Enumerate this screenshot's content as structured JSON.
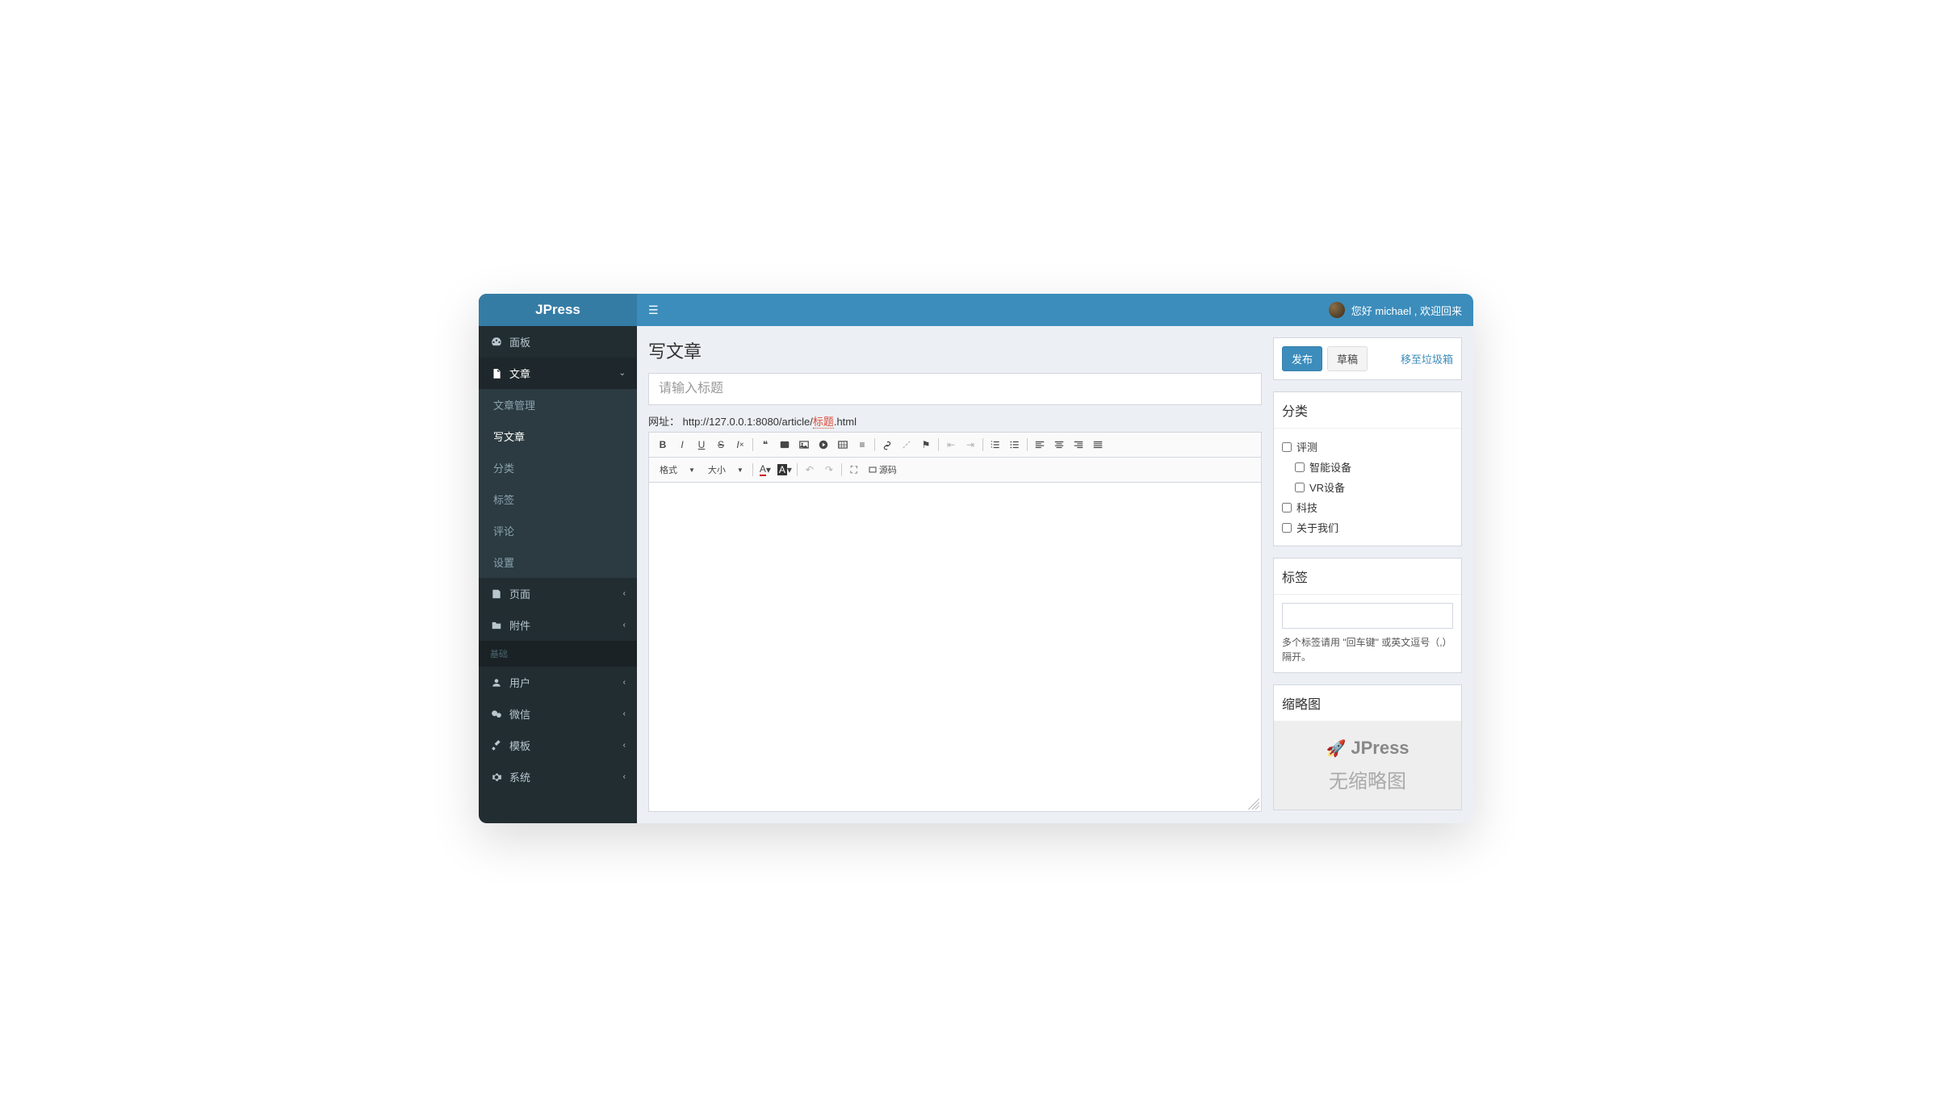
{
  "brand": "JPress",
  "topbar": {
    "greeting": "您好 michael , 欢迎回来"
  },
  "sidebar": {
    "dashboard": "面板",
    "article": "文章",
    "article_sub": {
      "manage": "文章管理",
      "write": "写文章",
      "category": "分类",
      "tag": "标签",
      "comment": "评论",
      "setting": "设置"
    },
    "page": "页面",
    "attachment": "附件",
    "base_header": "基础",
    "user": "用户",
    "wechat": "微信",
    "template": "模板",
    "system": "系统"
  },
  "page": {
    "title": "写文章",
    "title_placeholder": "请输入标题",
    "url_label": "网址：",
    "url_prefix": "http://127.0.0.1:8080/article/",
    "url_slug": "标题",
    "url_suffix": ".html"
  },
  "toolbar": {
    "format": "格式",
    "size": "大小",
    "source": "源码"
  },
  "actions": {
    "publish": "发布",
    "draft": "草稿",
    "trash": "移至垃圾箱"
  },
  "category": {
    "title": "分类",
    "items": [
      {
        "label": "评测",
        "indent": 0
      },
      {
        "label": "智能设备",
        "indent": 1
      },
      {
        "label": "VR设备",
        "indent": 1
      },
      {
        "label": "科技",
        "indent": 0
      },
      {
        "label": "关于我们",
        "indent": 0
      }
    ]
  },
  "tags": {
    "title": "标签",
    "hint": "多个标签请用 \"回车键\" 或英文逗号（,）隔开。"
  },
  "thumb": {
    "title": "缩略图",
    "brand": "JPress",
    "none": "无缩略图"
  }
}
